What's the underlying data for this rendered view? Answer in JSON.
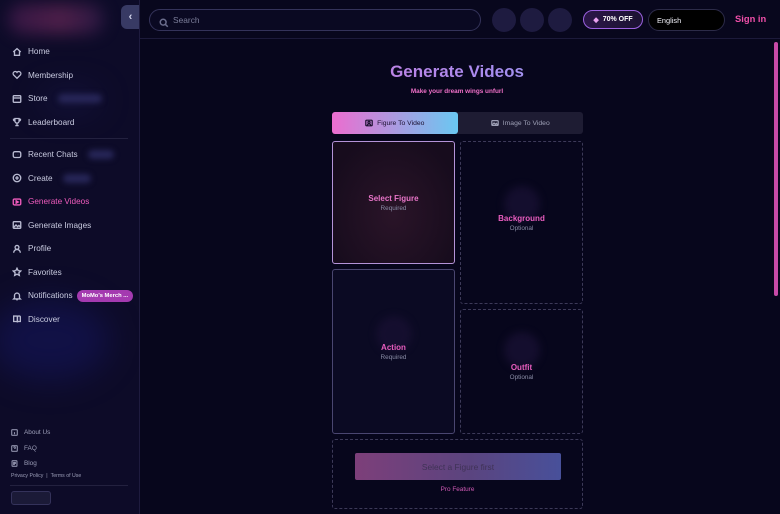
{
  "sidebar": {
    "collapse_glyph": "‹",
    "nav": [
      {
        "label": "Home",
        "icon": "home-icon"
      },
      {
        "label": "Membership",
        "icon": "heart-icon"
      },
      {
        "label": "Store",
        "icon": "store-icon"
      },
      {
        "label": "Leaderboard",
        "icon": "trophy-icon"
      },
      {
        "label": "Recent Chats",
        "icon": "chat-icon"
      },
      {
        "label": "Create",
        "icon": "plus-circle-icon"
      },
      {
        "label": "Generate Videos",
        "icon": "video-icon",
        "active": true
      },
      {
        "label": "Generate Images",
        "icon": "image-icon"
      },
      {
        "label": "Profile",
        "icon": "user-icon"
      },
      {
        "label": "Favorites",
        "icon": "star-icon"
      },
      {
        "label": "Notifications",
        "icon": "bell-icon",
        "badge": "MoMo's Merch ..."
      },
      {
        "label": "Discover",
        "icon": "compass-icon"
      }
    ],
    "footer": {
      "about": "About Us",
      "faq": "FAQ",
      "blog": "Blog",
      "privacy": "Privacy Policy",
      "separator": "|",
      "terms": "Terms of Use"
    }
  },
  "topbar": {
    "search_placeholder": "Search",
    "discount": "70% OFF",
    "language": "English",
    "signin": "Sign in"
  },
  "main": {
    "title": "Generate Videos",
    "subtitle": "Make your dream wings unfurl",
    "tabs": [
      {
        "label": "Figure To Video",
        "active": true
      },
      {
        "label": "Image To Video",
        "active": false
      }
    ],
    "cards": {
      "figure": {
        "label": "Select Figure",
        "sub": "Required"
      },
      "background": {
        "label": "Background",
        "sub": "Optional"
      },
      "action": {
        "label": "Action",
        "sub": "Required"
      },
      "outfit": {
        "label": "Outfit",
        "sub": "Optional"
      }
    },
    "cta": "Select a Figure first",
    "pro_note": "Pro Feature"
  },
  "colors": {
    "accent_pink": "#ef4fa9",
    "background": "#07061c",
    "sidebar": "#0d0b28"
  }
}
